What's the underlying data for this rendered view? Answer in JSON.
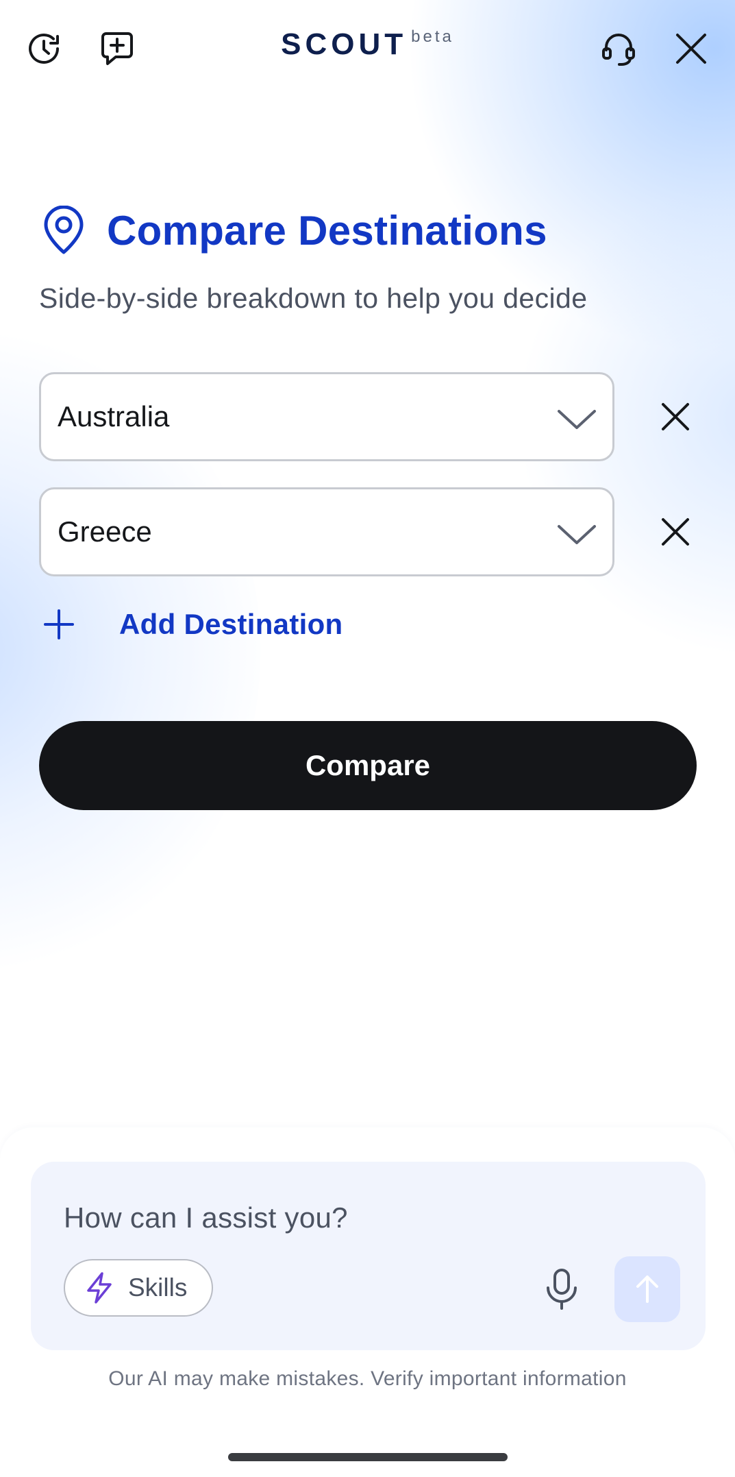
{
  "header": {
    "brand": "SCOUT",
    "brand_suffix": "beta",
    "icons": [
      "history-icon",
      "new-chat-icon",
      "support-headset-icon",
      "close-icon"
    ]
  },
  "main": {
    "title": "Compare Destinations",
    "subtitle": "Side-by-side breakdown to help you decide",
    "destinations": [
      {
        "value": "Australia"
      },
      {
        "value": "Greece"
      }
    ],
    "add_destination_label": "Add Destination",
    "compare_label": "Compare"
  },
  "composer": {
    "placeholder": "How can I assist you?",
    "skills_label": "Skills",
    "disclaimer": "Our AI may make mistakes. Verify important information"
  },
  "colors": {
    "accent": "#1238c4",
    "button_dark": "#141518",
    "send_disabled": "#dbe4ff",
    "skills_icon": "#6b3fd6"
  }
}
